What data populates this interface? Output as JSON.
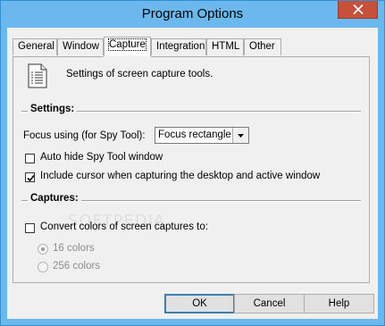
{
  "window": {
    "title": "Program Options"
  },
  "tabs": [
    {
      "label": "General"
    },
    {
      "label": "Window"
    },
    {
      "label": "Capture"
    },
    {
      "label": "Integration"
    },
    {
      "label": "HTML"
    },
    {
      "label": "Other"
    }
  ],
  "active_tab": "Capture",
  "description": "Settings of screen capture tools.",
  "settings": {
    "title": "Settings:",
    "focus_label": "Focus using (for Spy Tool):",
    "focus_value": "Focus rectangle",
    "auto_hide_label": "Auto hide Spy Tool window",
    "auto_hide_checked": false,
    "include_cursor_label": "Include cursor when capturing the desktop and active window",
    "include_cursor_checked": true
  },
  "captures": {
    "title": "Captures:",
    "convert_label": "Convert colors of screen captures to:",
    "convert_checked": false,
    "options": [
      {
        "label": "16 colors",
        "selected": true
      },
      {
        "label": "256 colors",
        "selected": false
      }
    ]
  },
  "buttons": {
    "ok": "OK",
    "cancel": "Cancel",
    "help": "Help"
  },
  "watermark": "SOFTPEDIA",
  "colors": {
    "titlebar": "#6ab8ee",
    "close_button": "#c7503a",
    "default_button_border": "#3c7fb1"
  }
}
